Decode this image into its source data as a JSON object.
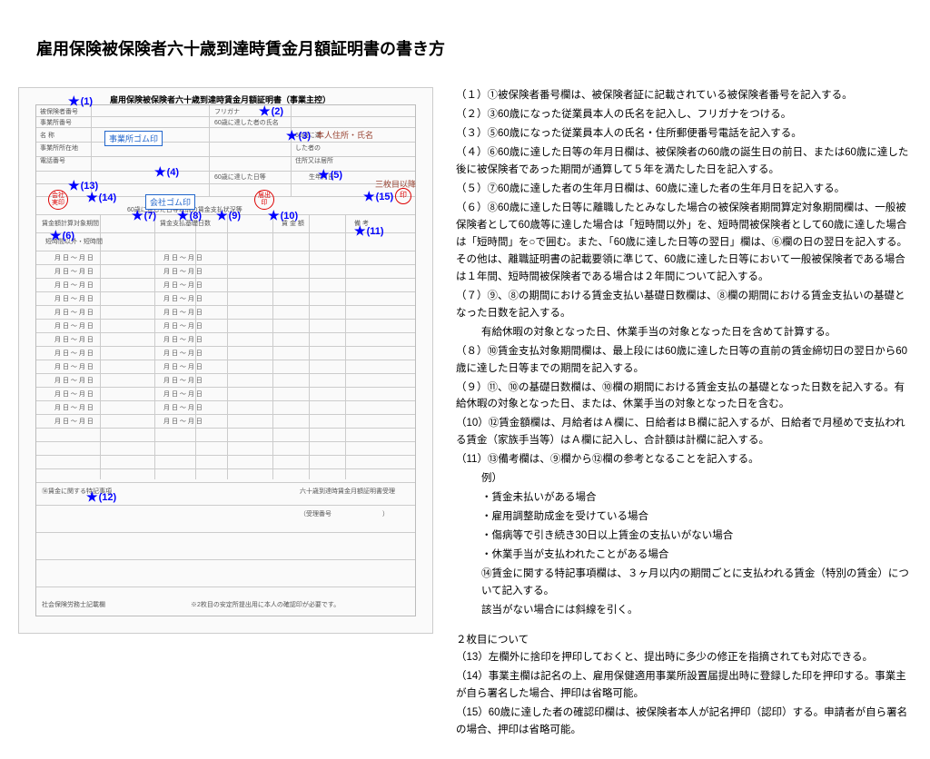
{
  "title": "雇用保険被保険者六十歳到達時賃金月額証明書の書き方",
  "form": {
    "heading": "雇用保険被保険者六十歳到達時賃金月額証明書（事業主控）",
    "label_furigana": "フリガナ",
    "label_name": "60歳に達した者の氏名",
    "box_office_stamp": "事業所ゴム印",
    "box_company_stamp": "会社ゴム印",
    "annot_address": "本人住所・氏名",
    "annot_3sheets": "三枚目以降",
    "stamp_company": "会社実印",
    "stamp_since": "届出印",
    "stamp_confirm": "印",
    "section_wages": "60歳に達した日等以前の賃金支払状況等",
    "col_wage_calc": "賃金額計算対象期間",
    "col_days": "賃金支払基礎日数",
    "col_wage": "賃 金 額",
    "col_remark": "備 考",
    "row_pattern": "月  日 ～  月  日",
    "bottom_note": "※2枚目の安定所提出用に本人の確認印が必要です。",
    "receipt_box": "六十歳到達時賃金月額証明書受理"
  },
  "markers": {
    "m1": "(1)",
    "m2": "(2)",
    "m3": "(3)",
    "m4": "(4)",
    "m5": "(5)",
    "m6": "(6)",
    "m7": "(7)",
    "m8": "(8)",
    "m9": "(9)",
    "m10": "(10)",
    "m11": "(11)",
    "m12": "(12)",
    "m13": "(13)",
    "m14": "(14)",
    "m15": "(15)"
  },
  "instructions": {
    "i1": "（１）①被保険者番号欄は、被保険者証に記載されている被保険者番号を記入する。",
    "i2": "（２）③60歳になった従業員本人の氏名を記入し、フリガナをつける。",
    "i3": "（３）⑤60歳になった従業員本人の氏名・住所郵便番号電話を記入する。",
    "i4": "（４）⑥60歳に達した日等の年月日欄は、被保険者の60歳の誕生日の前日、または60歳に達した後に被保険者であった期間が通算して５年を満たした日を記入する。",
    "i5": "（５）⑦60歳に達した者の生年月日欄は、60歳に達した者の生年月日を記入する。",
    "i6": "（６）⑧60歳に達した日等に離職したとみなした場合の被保険者期間算定対象期間欄は、一般被保険者として60歳等に達した場合は「短時間以外」を、短時間被保険者として60歳に達した場合は「短時間」を○で囲む。また、「60歳に達した日等の翌日」欄は、⑥欄の日の翌日を記入する。その他は、離職証明書の記載要領に準じて、60歳に達した日等において一般被保険者である場合は１年間、短時間被保険者である場合は２年間について記入する。",
    "i7": "（７）⑨、⑧の期間における賃金支払い基礎日数欄は、⑧欄の期間における賃金支払いの基礎となった日数を記入する。",
    "i7sub": "有給休暇の対象となった日、休業手当の対象となった日を含めて計算する。",
    "i8": "（８）⑩賃金支払対象期間欄は、最上段には60歳に達した日等の直前の賃金締切日の翌日から60歳に達した日等までの期間を記入する。",
    "i9": "（９）⑪、⑩の基礎日数欄は、⑩欄の期間における賃金支払の基礎となった日数を記入する。有給休暇の対象となった日、または、休業手当の対象となった日を含む。",
    "i10": "（10）⑫賃金額欄は、月給者はＡ欄に、日給者はＢ欄に記入するが、日給者で月極めで支払われる賃金（家族手当等）はＡ欄に記入し、合計額は計欄に記入する。",
    "i11": "（11）⑬備考欄は、⑨欄から⑫欄の参考となることを記入する。",
    "i11ex": "例）",
    "i11a": "・賃金未払いがある場合",
    "i11b": "・雇用調整助成金を受けている場合",
    "i11c": "・傷病等で引き続き30日以上賃金の支払いがない場合",
    "i11d": "・休業手当が支払われたことがある場合",
    "i11e": "⑭賃金に関する特記事項欄は、３ヶ月以内の期間ごとに支払われる賃金（特別の賃金）について記入する。",
    "i11f": "該当がない場合には斜線を引く。",
    "page2_title": "２枚目について",
    "i13": "（13）左欄外に捨印を押印しておくと、提出時に多少の修正を指摘されても対応できる。",
    "i14": "（14）事業主欄は記名の上、雇用保健適用事業所設置届提出時に登録した印を押印する。事業主が自ら署名した場合、押印は省略可能。",
    "i15": "（15）60歳に達した者の確認印欄は、被保険者本人が記名押印（認印）する。申請者が自ら署名の場合、押印は省略可能。"
  }
}
